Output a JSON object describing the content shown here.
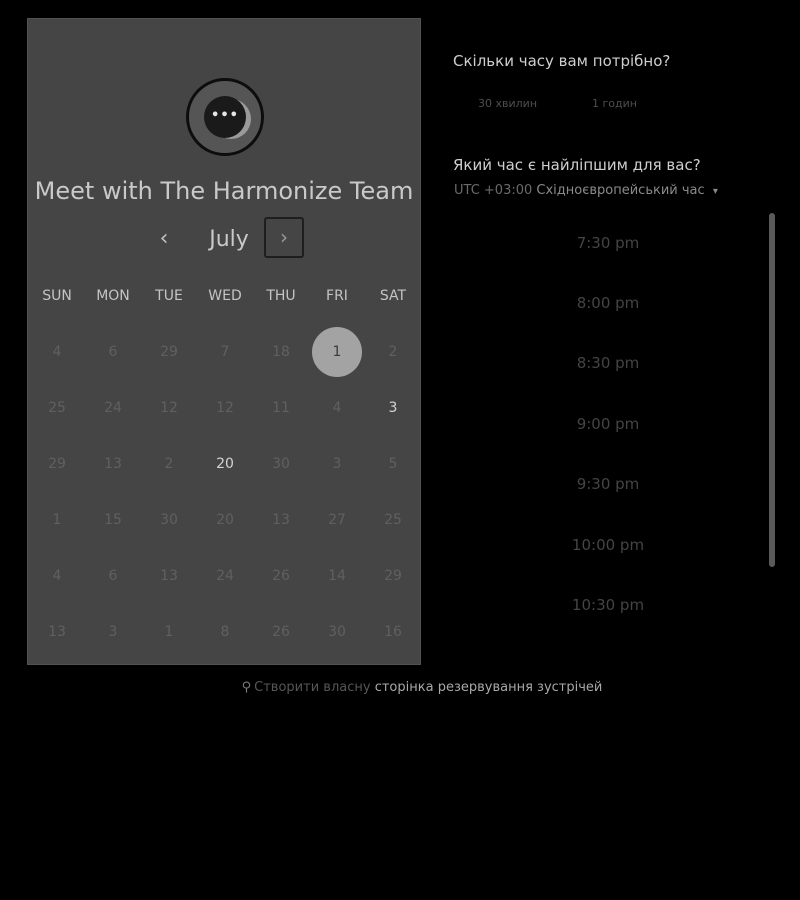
{
  "booking": {
    "title": "Meet with The Harmonize Team",
    "month": "July",
    "prev_icon": "chevron-left-icon",
    "next_icon": "chevron-right-icon",
    "weekdays": [
      "SUN",
      "MON",
      "TUE",
      "WED",
      "THU",
      "FRI",
      "SAT"
    ],
    "weeks": [
      [
        "4",
        "6",
        "29",
        "7",
        "18",
        "1",
        "2"
      ],
      [
        "25",
        "24",
        "12",
        "12",
        "11",
        "4",
        "3"
      ],
      [
        "29",
        "13",
        "2",
        "20",
        "30",
        "3",
        "5"
      ],
      [
        "1",
        "15",
        "30",
        "20",
        "13",
        "27",
        "25"
      ],
      [
        "4",
        "6",
        "13",
        "24",
        "26",
        "14",
        "29"
      ],
      [
        "13",
        "3",
        "1",
        "8",
        "26",
        "30",
        "16"
      ]
    ],
    "selected_day": "1",
    "available_days": [
      "3",
      "20"
    ]
  },
  "duration": {
    "question": "Скільки часу вам потрібно?",
    "options": [
      "30 хвилин",
      "1 годин"
    ]
  },
  "time": {
    "question": "Який час є найліпшим для вас?",
    "timezone_offset": "UTC +03:00",
    "timezone_name": "Східноєвропейський час",
    "slots": [
      "7:30 pm",
      "8:00 pm",
      "8:30 pm",
      "9:00 pm",
      "9:30 pm",
      "10:00 pm",
      "10:30 pm"
    ]
  },
  "footer": {
    "icon": "hubspot-sprocket-icon",
    "text_dim": "Створити власну",
    "text_link": "сторінка резервування зустрічей"
  },
  "colors": {
    "background": "#000000",
    "panel": "#454545",
    "selected_day": "#a3a3a3"
  }
}
